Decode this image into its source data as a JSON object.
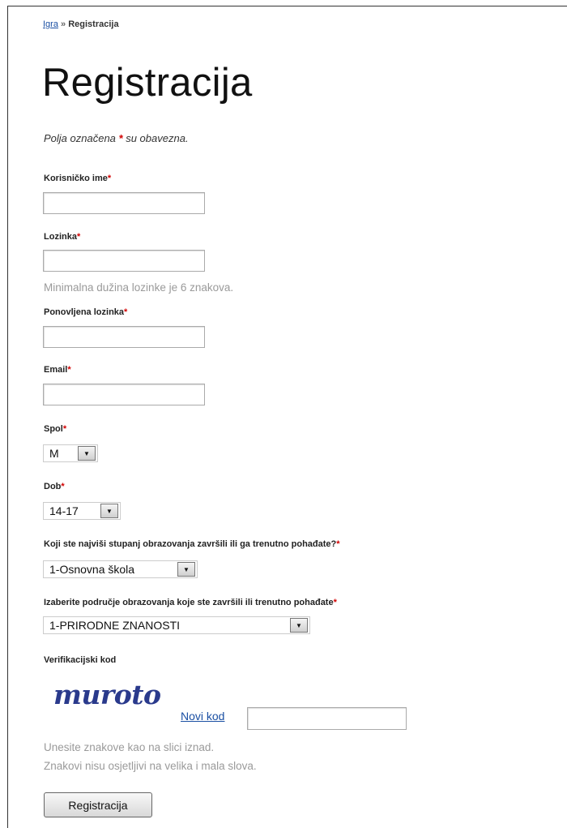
{
  "breadcrumb": {
    "home": "Igra",
    "separator": "»",
    "current": "Registracija"
  },
  "page_title": "Registracija",
  "required_note": {
    "before": "Polja označena",
    "star": "*",
    "after": "su obavezna."
  },
  "fields": {
    "username": {
      "label": "Korisničko ime",
      "value": ""
    },
    "password": {
      "label": "Lozinka",
      "value": "",
      "hint": "Minimalna dužina lozinke je 6 znakova."
    },
    "password_repeat": {
      "label": "Ponovljena lozinka",
      "value": ""
    },
    "email": {
      "label": "Email",
      "value": ""
    },
    "gender": {
      "label": "Spol",
      "value": "M"
    },
    "age": {
      "label": "Dob",
      "value": "14-17"
    },
    "education_level": {
      "label": "Koji ste najviši stupanj obrazovanja završili ili ga trenutno pohađate?",
      "value": "1-Osnovna škola"
    },
    "education_field": {
      "label": "Izaberite područje obrazovanja koje ste završili ili trenutno pohađate",
      "value": "1-PRIRODNE ZNANOSTI"
    }
  },
  "required_mark": "*",
  "captcha": {
    "label": "Verifikacijski kod",
    "image_text": "muroto",
    "new_code_link": "Novi kod",
    "value": "",
    "hint_line1": "Unesite znakove kao na slici iznad.",
    "hint_line2": "Znakovi nisu osjetljivi na velika i mala slova."
  },
  "submit_label": "Registracija",
  "colors": {
    "required": "#d20000",
    "link": "#1a4fa3",
    "hint": "#9a9a9a"
  },
  "icons": {
    "dropdown": "chevron-down-icon"
  }
}
